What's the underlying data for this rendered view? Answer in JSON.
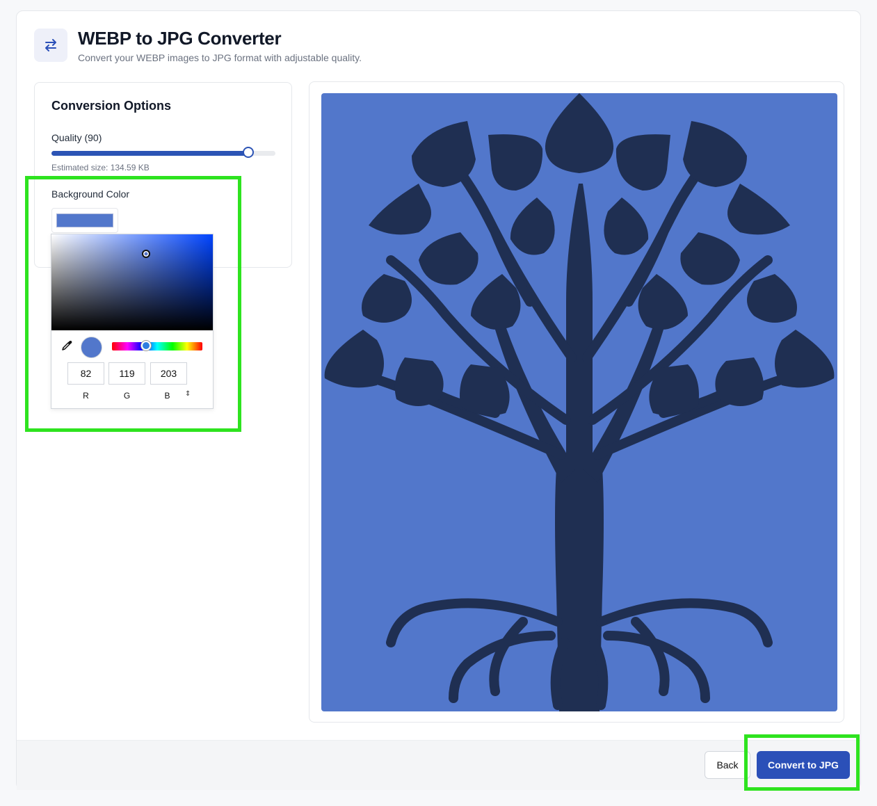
{
  "header": {
    "title": "WEBP to JPG Converter",
    "subtitle": "Convert your WEBP images to JPG format with adjustable quality.",
    "icon": "swap-arrows-icon"
  },
  "options": {
    "title": "Conversion Options",
    "quality_label": "Quality (90)",
    "quality_value": 90,
    "quality_min": 0,
    "quality_max": 100,
    "estimated_size": "Estimated size: 134.59 KB",
    "background_label": "Background Color",
    "background_color": "#5277cb"
  },
  "color_picker": {
    "r": "82",
    "g": "119",
    "b": "203",
    "r_label": "R",
    "g_label": "G",
    "b_label": "B",
    "mode_toggle": "⇕",
    "hue_base": "#0044ff"
  },
  "preview": {
    "background": "#5277cb",
    "tree_color": "#1f2f52",
    "icon": "tree-image"
  },
  "footer": {
    "back_label": "Back",
    "convert_label": "Convert to JPG"
  },
  "colors": {
    "accent": "#2b50b8",
    "highlight": "#2ee31f"
  }
}
